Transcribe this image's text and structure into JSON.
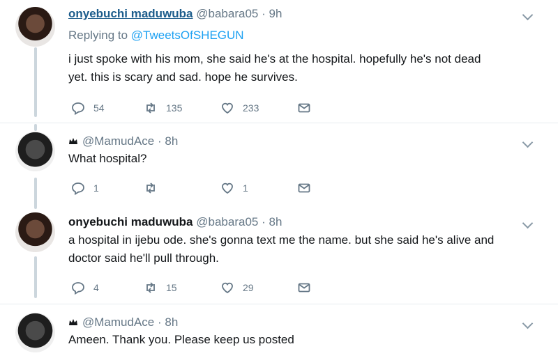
{
  "tweets": [
    {
      "name": "onyebuchi maduwuba",
      "handle": "@babara05",
      "time": "9h",
      "replying_prefix": "Replying to ",
      "replying_to": "@TweetsOfSHEGUN",
      "line1": "i just spoke with his mom, she said he's at the hospital. hopefully he's not dead",
      "line2": "yet. this is scary and sad. hope he survives.",
      "replies": "54",
      "retweets": "135",
      "likes": "233"
    },
    {
      "name": "",
      "handle": "@MamudAce",
      "time": "8h",
      "line1": "What hospital?",
      "replies": "1",
      "retweets": "",
      "likes": "1"
    },
    {
      "name": "onyebuchi maduwuba",
      "handle": "@babara05",
      "time": "8h",
      "line1": "a hospital in ijebu ode. she's gonna text me the name. but she said he's alive and",
      "line2": "doctor said he'll pull through.",
      "replies": "4",
      "retweets": "15",
      "likes": "29"
    },
    {
      "name": "",
      "handle": "@MamudAce",
      "time": "8h",
      "line1": "Ameen. Thank you. Please keep us posted"
    }
  ],
  "dot": "·",
  "icons": [
    "reply-icon",
    "retweet-icon",
    "like-icon",
    "dm-icon",
    "chevron-down-icon",
    "crown-badge-icon"
  ]
}
